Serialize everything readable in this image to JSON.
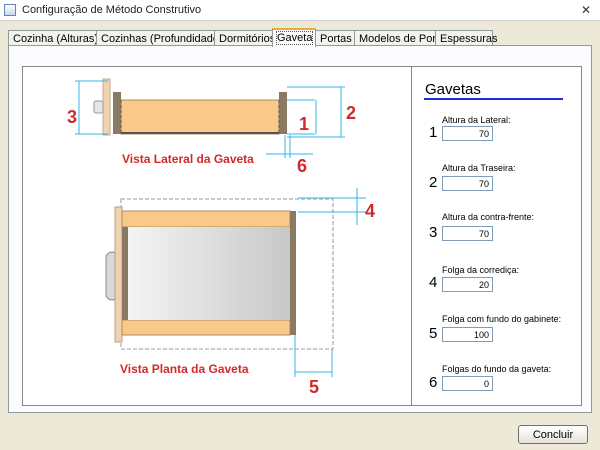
{
  "window": {
    "title": "Configuração de Método Construtivo",
    "close_glyph": "✕"
  },
  "tabs": [
    {
      "label": "Cozinha (Alturas)"
    },
    {
      "label": "Cozinhas (Profundidades)"
    },
    {
      "label": "Dormitórios"
    },
    {
      "label": "Gaveta",
      "active": true
    },
    {
      "label": "Portas"
    },
    {
      "label": "Modelos de Porta"
    },
    {
      "label": "Espessuras"
    }
  ],
  "drawing": {
    "lateral_caption": "Vista Lateral da Gaveta",
    "plant_caption": "Vista Planta da Gaveta",
    "markers": {
      "m1": "1",
      "m2": "2",
      "m3": "3",
      "m4": "4",
      "m5": "5",
      "m6": "6"
    },
    "colors": {
      "wood": "#f9c98a",
      "wood_dark": "#8a7a64",
      "dimension": "#36b4e8",
      "caption": "#d12a2a"
    }
  },
  "props": {
    "title": "Gavetas",
    "fields": [
      {
        "num": "1",
        "label": "Altura da Lateral:",
        "value": "70"
      },
      {
        "num": "2",
        "label": "Altura da Traseira:",
        "value": "70"
      },
      {
        "num": "3",
        "label": "Altura da contra-frente:",
        "value": "70"
      },
      {
        "num": "4",
        "label": "Folga da corrediça:",
        "value": "20"
      },
      {
        "num": "5",
        "label": "Folga com fundo do gabinete:",
        "value": "100"
      },
      {
        "num": "6",
        "label": "Folgas do fundo da gaveta:",
        "value": "0"
      }
    ]
  },
  "buttons": {
    "conclude_label": "Concluir"
  }
}
